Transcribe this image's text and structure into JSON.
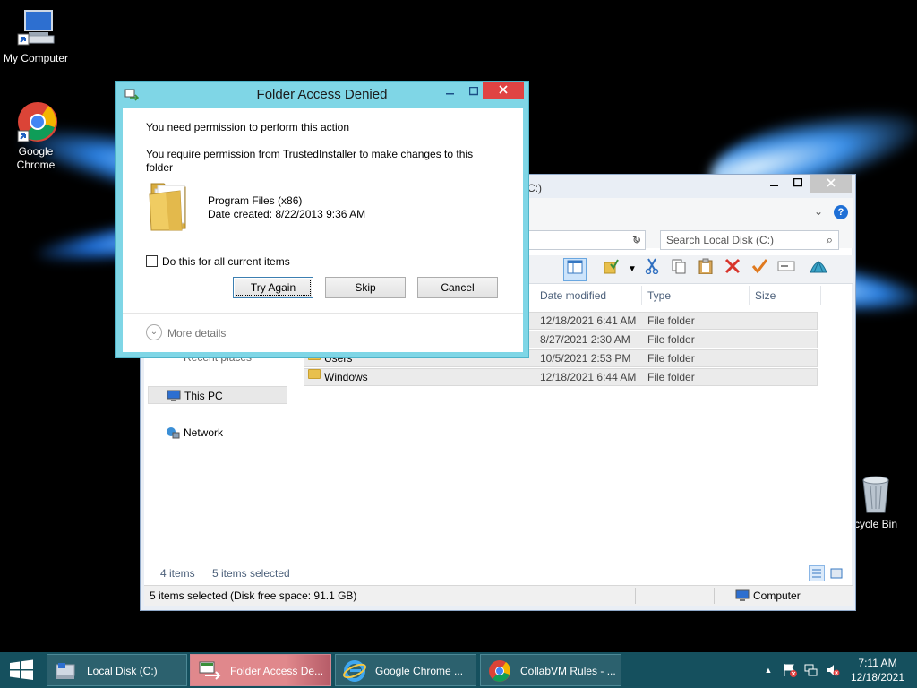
{
  "desktop": {
    "icons": [
      {
        "label": "My Computer"
      },
      {
        "label": "Google Chrome"
      },
      {
        "label": "cycle Bin"
      }
    ]
  },
  "explorer": {
    "title_fragment": "C:)",
    "search_placeholder": "Search Local Disk (C:)",
    "columns": [
      "Date modified",
      "Type",
      "Size"
    ],
    "rows": [
      {
        "name": "",
        "date": "12/18/2021 6:41 AM",
        "type": "File folder"
      },
      {
        "name": "",
        "date": "8/27/2021 2:30 AM",
        "type": "File folder"
      },
      {
        "name": "Users",
        "date": "10/5/2021 2:53 PM",
        "type": "File folder"
      },
      {
        "name": "Windows",
        "date": "12/18/2021 6:44 AM",
        "type": "File folder"
      }
    ],
    "nav": {
      "recent": "Recent places",
      "thispc": "This PC",
      "network": "Network"
    },
    "status": {
      "count": "4 items",
      "selected": "5 items selected",
      "bar_left": "5 items selected (Disk free space: 91.1 GB)",
      "bar_right": "Computer"
    }
  },
  "dialog": {
    "title": "Folder Access Denied",
    "message1": "You need permission to perform this action",
    "message2": "You require permission from TrustedInstaller to make changes to this folder",
    "folder_name": "Program Files (x86)",
    "date_created": "Date created: 8/22/2013 9:36 AM",
    "checkbox_label": "Do this for all current items",
    "buttons": {
      "try_again": "Try Again",
      "skip": "Skip",
      "cancel": "Cancel"
    },
    "more_details": "More details"
  },
  "taskbar": {
    "tasks": [
      {
        "label": "Local Disk (C:)"
      },
      {
        "label": "Folder Access De..."
      },
      {
        "label": "Google Chrome ..."
      },
      {
        "label": "CollabVM Rules - ..."
      }
    ],
    "clock": {
      "time": "7:11 AM",
      "date": "12/18/2021"
    }
  },
  "colors": {
    "dialog_frame": "#7fd6e6",
    "close_button": "#e04343",
    "taskbar": "#15505e",
    "active_task": "#e0888c"
  }
}
